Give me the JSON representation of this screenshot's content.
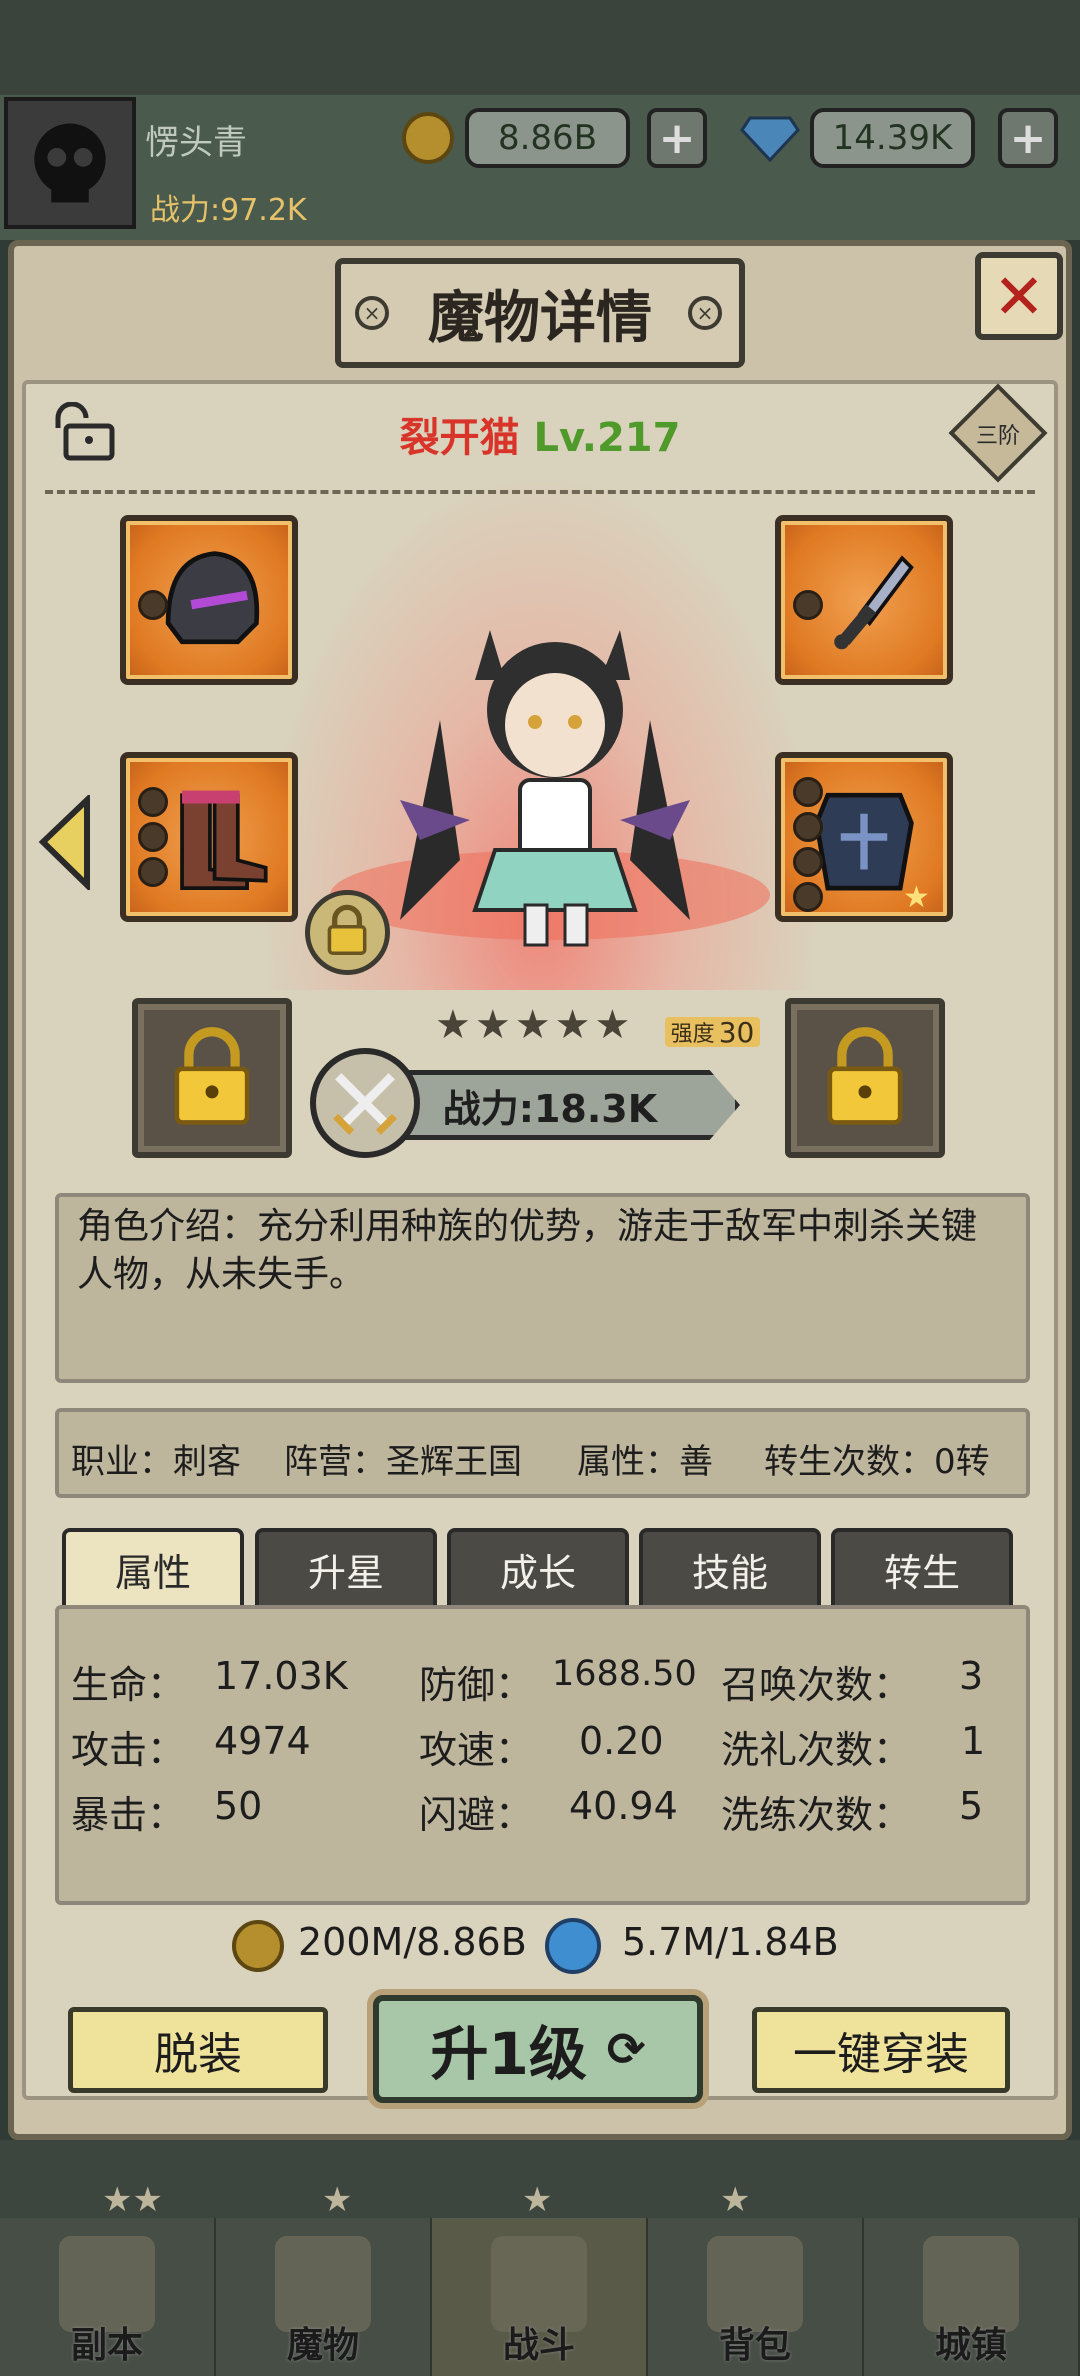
{
  "player": {
    "name": "愣头青",
    "power": "战力:97.2K"
  },
  "currency": {
    "gold": "8.86B",
    "diamonds": "14.39K",
    "plus": "+"
  },
  "dialog": {
    "title": "魔物详情",
    "close": "✕"
  },
  "monster": {
    "name": "裂开猫",
    "level": "Lv.217",
    "tier": "三阶",
    "strength_label": "强度",
    "strength_value": "30",
    "stars": 5,
    "power": "战力:18.3K"
  },
  "description": "角色介绍：充分利用种族的优势，游走于敌军中刺杀关键人物，从未失手。",
  "info": {
    "job": "职业：刺客",
    "camp": "阵营：圣辉王国",
    "attribute": "属性：善",
    "rebirth": "转生次数：0转"
  },
  "tabs": [
    "属性",
    "升星",
    "成长",
    "技能",
    "转生"
  ],
  "stats": {
    "hp_label": "生命：",
    "hp": "17.03K",
    "atk_label": "攻击：",
    "atk": "4974",
    "crit_label": "暴击：",
    "crit": "50",
    "def_label": "防御：",
    "def": "1688.50",
    "spd_label": "攻速：",
    "spd": "0.20",
    "dodge_label": "闪避：",
    "dodge": "40.94",
    "summon_label": "召唤次数：",
    "summon": "3",
    "baptism_label": "洗礼次数：",
    "baptism": "1",
    "refine_label": "洗练次数：",
    "refine": "5"
  },
  "costs": {
    "gold": "200M/8.86B",
    "orb": "5.7M/1.84B"
  },
  "buttons": {
    "unequip": "脱装",
    "upgrade": "升1级",
    "equip_all": "一键穿装"
  },
  "nav": [
    "副本",
    "魔物",
    "战斗",
    "背包",
    "城镇"
  ],
  "colors": {
    "name_red": "#d8342a",
    "level_green": "#4f9a2b",
    "slot_orange": "#e07a23",
    "button_yellow": "#efe39b",
    "upgrade_green": "#a8c7a8"
  }
}
